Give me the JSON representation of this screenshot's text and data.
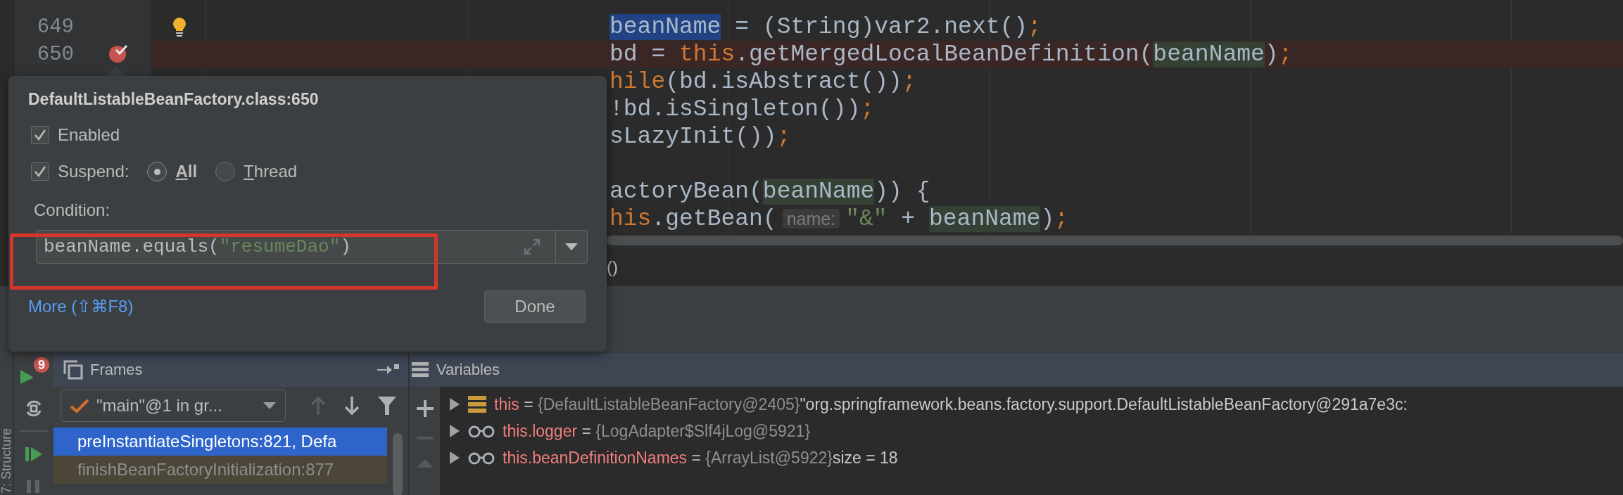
{
  "editor": {
    "lines": [
      {
        "kind": "code",
        "number": "649",
        "bulb": true,
        "breakpoint": false,
        "highlighted": false,
        "segments": [
          {
            "text": "beanName",
            "kind": "selection"
          },
          {
            "text": " = (String)var2.next()",
            "kind": "plain"
          },
          {
            "text": ";",
            "kind": "keyword"
          }
        ]
      },
      {
        "kind": "code",
        "number": "650",
        "bulb": false,
        "breakpoint": true,
        "highlighted": true,
        "segments": [
          {
            "text": "bd = ",
            "kind": "plain"
          },
          {
            "text": "this",
            "kind": "keyword"
          },
          {
            "text": ".getMergedLocalBeanDefinition(",
            "kind": "plain"
          },
          {
            "text": "beanName",
            "kind": "usage"
          },
          {
            "text": ")",
            "kind": "plain"
          },
          {
            "text": ";",
            "kind": "keyword"
          }
        ]
      },
      {
        "kind": "code",
        "highlighted": false,
        "segments": [
          {
            "text": "hile",
            "kind": "keyword"
          },
          {
            "text": "(bd.isAbstract())",
            "kind": "plain"
          },
          {
            "text": ";",
            "kind": "keyword"
          }
        ]
      },
      {
        "kind": "code",
        "highlighted": false,
        "segments": [
          {
            "text": "!bd.isSingleton())",
            "kind": "plain"
          },
          {
            "text": ";",
            "kind": "keyword"
          }
        ]
      },
      {
        "kind": "code",
        "highlighted": false,
        "segments": [
          {
            "text": "sLazyInit())",
            "kind": "plain"
          },
          {
            "text": ";",
            "kind": "keyword"
          }
        ]
      },
      {
        "kind": "blank"
      },
      {
        "kind": "code",
        "highlighted": false,
        "segments": [
          {
            "text": "actoryBean(",
            "kind": "plain"
          },
          {
            "text": "beanName",
            "kind": "usage"
          },
          {
            "text": ")) {",
            "kind": "plain"
          }
        ]
      },
      {
        "kind": "code",
        "highlighted": false,
        "segments": [
          {
            "text": "his",
            "kind": "keyword"
          },
          {
            "text": ".getBean(",
            "kind": "plain"
          },
          {
            "text": "name:",
            "kind": "hint"
          },
          {
            "text": "\"&\"",
            "kind": "string"
          },
          {
            "text": " + ",
            "kind": "plain"
          },
          {
            "text": "beanName",
            "kind": "usage"
          },
          {
            "text": ")",
            "kind": "plain"
          },
          {
            "text": ";",
            "kind": "keyword"
          }
        ]
      }
    ],
    "output_text": "()"
  },
  "popup": {
    "title": "DefaultListableBeanFactory.class:650",
    "enabled": {
      "label": "Enabled",
      "checked": true
    },
    "suspend": {
      "label": "Suspend:",
      "checked": true,
      "options": [
        {
          "label": "All",
          "selected": true
        },
        {
          "label": "Thread",
          "selected": false
        }
      ]
    },
    "condition": {
      "label": "Condition:",
      "segments": [
        {
          "text": "beanName.equals(",
          "kind": "plain"
        },
        {
          "text": "\"resumeDao\"",
          "kind": "string"
        },
        {
          "text": ")",
          "kind": "plain"
        }
      ]
    },
    "more_link": "More (⇧⌘F8)",
    "done_button": "Done"
  },
  "debug": {
    "stripe_label": "7: Structure",
    "resume_badge": "9",
    "frames": {
      "title": "Frames",
      "thread": "\"main\"@1 in gr...",
      "items": [
        {
          "label": "preInstantiateSingletons:821, Defa",
          "selected": true,
          "library": false
        },
        {
          "label": "finishBeanFactoryInitialization:877",
          "selected": false,
          "library": true
        }
      ]
    },
    "variables": {
      "title": "Variables",
      "items": [
        {
          "kind": "object",
          "name": "this",
          "eq": "=",
          "value": "{DefaultListableBeanFactory@2405}",
          "extra": "\"org.springframework.beans.factory.support.DefaultListableBeanFactory@291a7e3c:"
        },
        {
          "kind": "field",
          "name": "this.logger",
          "eq": "=",
          "value": "{LogAdapter$Slf4jLog@5921}"
        },
        {
          "kind": "field",
          "name": "this.beanDefinitionNames",
          "eq": "=",
          "value": "{ArrayList@5922}",
          "extra": "size = 18"
        }
      ]
    }
  }
}
